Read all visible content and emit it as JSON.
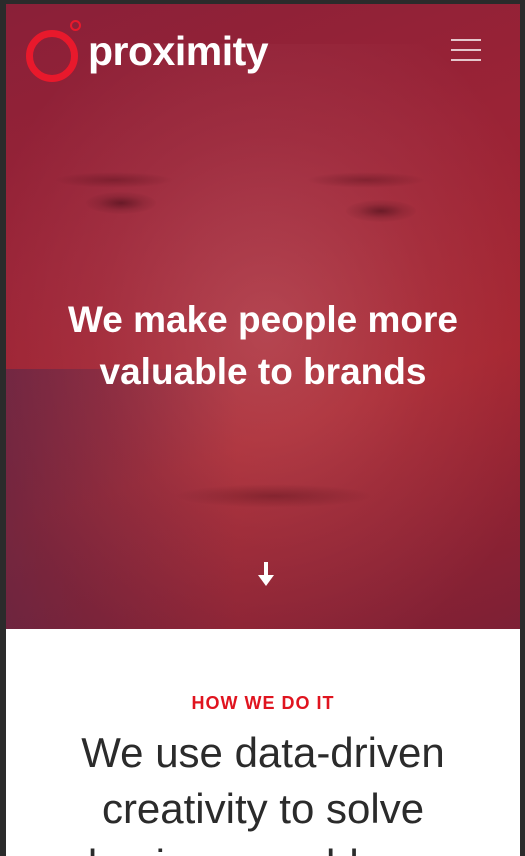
{
  "header": {
    "logo_text": "proximity",
    "logo_color": "#e8192c",
    "menu_icon": "hamburger-menu-icon"
  },
  "hero": {
    "headline_line1": "We make people more",
    "headline_line2": "valuable to brands",
    "scroll_icon": "arrow-down-icon",
    "background_color": "#9a2336"
  },
  "section": {
    "eyebrow": "HOW WE DO IT",
    "title_line1": "We use data-driven",
    "title_line2": "creativity to solve",
    "title_line3": "business problems",
    "accent_color": "#e0141f"
  }
}
